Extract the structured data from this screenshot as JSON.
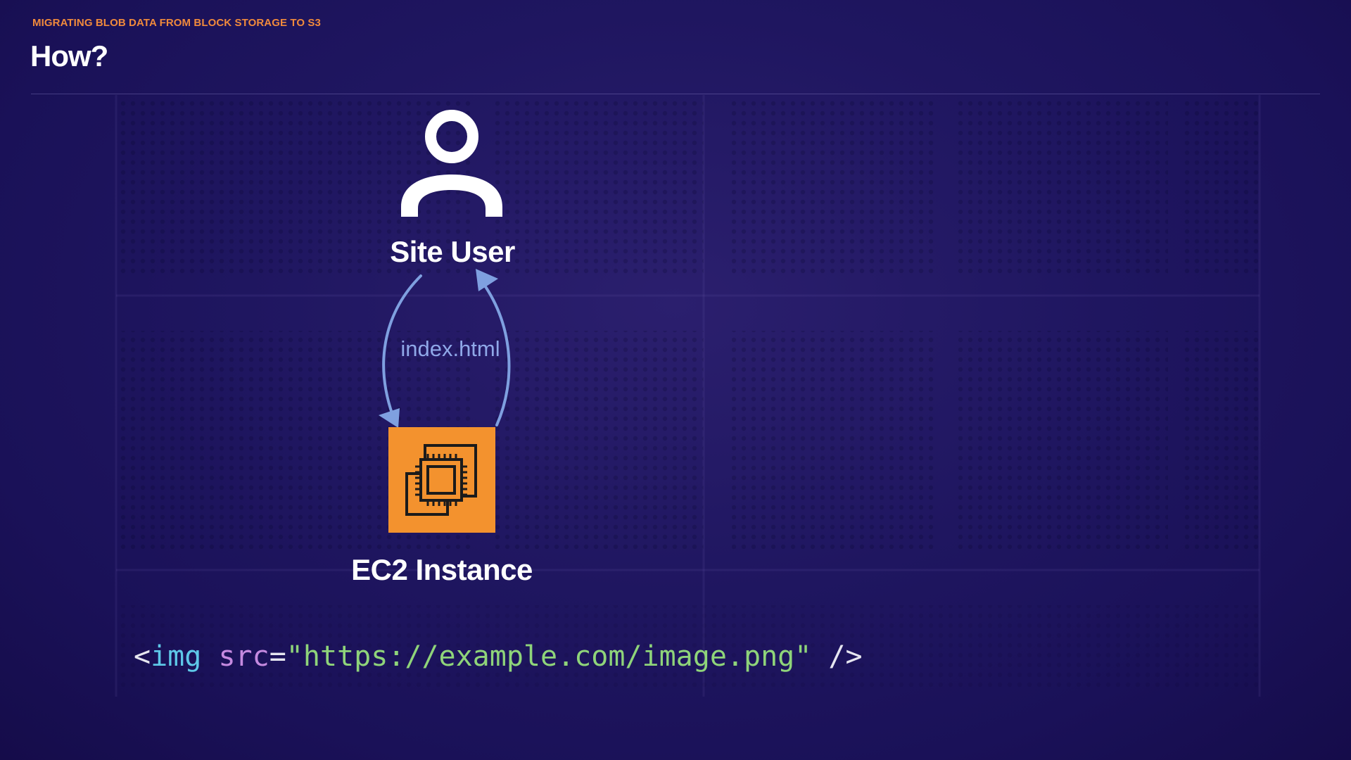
{
  "header": {
    "kicker": "MIGRATING BLOB DATA FROM BLOCK STORAGE TO S3",
    "title": "How?"
  },
  "diagram": {
    "nodes": [
      {
        "id": "user",
        "label": "Site User",
        "icon": "person-icon"
      },
      {
        "id": "ec2",
        "label": "EC2 Instance",
        "icon": "ec2-chip-icon"
      }
    ],
    "edges": [
      {
        "from": "user",
        "to": "ec2",
        "label": ""
      },
      {
        "from": "ec2",
        "to": "user",
        "label": "index.html"
      }
    ],
    "flow_label": "index.html"
  },
  "code": {
    "open": "<",
    "tag": "img",
    "space": " ",
    "attr": "src",
    "equals": "=",
    "value": "\"https://example.com/image.png\"",
    "close": " />"
  },
  "colors": {
    "background": "#1f1660",
    "accent": "#f08a3c",
    "ec2_orange": "#f3922e",
    "arrow_blue": "#7fa0e0",
    "code_tag": "#5ec8e8",
    "code_attr": "#c58ae0",
    "code_string": "#8fd47a"
  }
}
